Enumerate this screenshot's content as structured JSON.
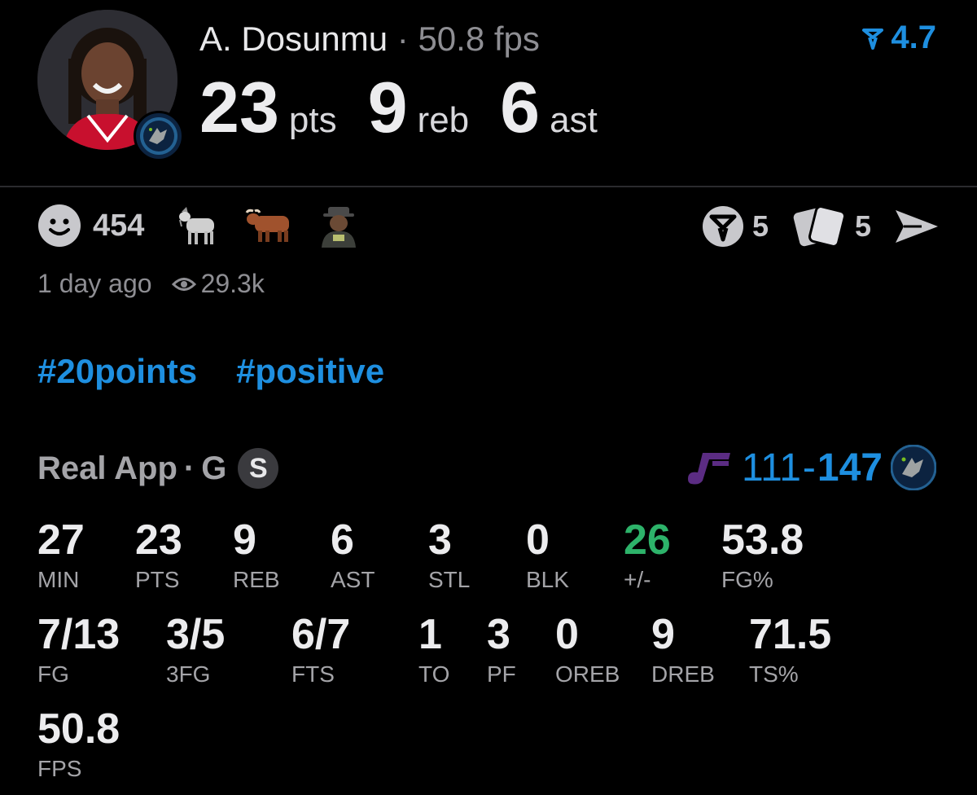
{
  "player": {
    "name": "A. Dosunmu",
    "separator": "·",
    "fps_text": "50.8 fps"
  },
  "statline": [
    {
      "value": "23",
      "unit": "pts"
    },
    {
      "value": "9",
      "unit": "reb"
    },
    {
      "value": "6",
      "unit": "ast"
    }
  ],
  "rating": {
    "value": "4.7",
    "icon": "rating-arrow-icon",
    "color": "#1e8fe0"
  },
  "reactions": {
    "count": "454",
    "icons": [
      "smile-icon",
      "goat-emoji",
      "bull-emoji",
      "person-sticker"
    ]
  },
  "actions": {
    "predictions_count": "5",
    "cards_count": "5",
    "icons": [
      "predictions-icon",
      "cards-icon",
      "share-icon"
    ]
  },
  "meta": {
    "time": "1 day ago",
    "views": "29.3k"
  },
  "tags": [
    "#20points",
    "#positive"
  ],
  "game": {
    "source": "Real App",
    "separator": "·",
    "position": "G",
    "badge": "S",
    "score_home": "111",
    "score_dash": "-",
    "score_away": "147"
  },
  "stats_row1": [
    {
      "label": "MIN",
      "value": "27"
    },
    {
      "label": "PTS",
      "value": "23"
    },
    {
      "label": "REB",
      "value": "9"
    },
    {
      "label": "AST",
      "value": "6"
    },
    {
      "label": "STL",
      "value": "3"
    },
    {
      "label": "BLK",
      "value": "0"
    },
    {
      "label": "+/-",
      "value": "26"
    },
    {
      "label": "FG%",
      "value": "53.8"
    }
  ],
  "stats_row2": [
    {
      "label": "FG",
      "value": "7/13"
    },
    {
      "label": "3FG",
      "value": "3/5"
    },
    {
      "label": "FTS",
      "value": "6/7"
    },
    {
      "label": "TO",
      "value": "1"
    },
    {
      "label": "PF",
      "value": "3"
    },
    {
      "label": "OREB",
      "value": "0"
    },
    {
      "label": "DREB",
      "value": "9"
    },
    {
      "label": "TS%",
      "value": "71.5"
    }
  ],
  "stats_row3": [
    {
      "label": "FPS",
      "value": "50.8"
    }
  ],
  "colors": {
    "accent": "#1e8fe0",
    "positive": "#2db36a",
    "background": "#000000"
  }
}
